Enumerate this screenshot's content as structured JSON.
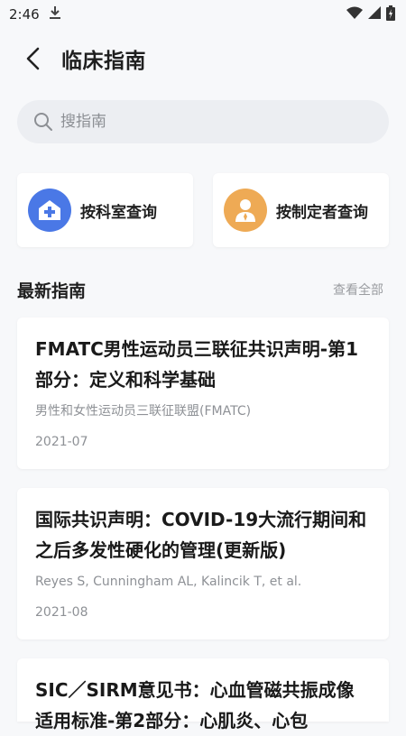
{
  "status_bar": {
    "time": "2:46"
  },
  "header": {
    "title": "临床指南"
  },
  "search": {
    "placeholder": "搜指南"
  },
  "query_cards": [
    {
      "label": "按科室查询",
      "icon": "hospital-icon",
      "color": "#4a78e6"
    },
    {
      "label": "按制定者查询",
      "icon": "person-icon",
      "color": "#eeaa55"
    }
  ],
  "section": {
    "title": "最新指南",
    "view_all": "查看全部"
  },
  "guides": [
    {
      "title": "FMATC男性运动员三联征共识声明-第1部分：定义和科学基础",
      "author": "男性和女性运动员三联征联盟(FMATC)",
      "date": "2021-07"
    },
    {
      "title": "国际共识声明：COVID-19大流行期间和之后多发性硬化的管理(更新版)",
      "author": "Reyes S, Cunningham AL, Kalincik T, et al.",
      "date": "2021-08"
    },
    {
      "title": "SIC／SIRM意见书：心血管磁共振成像适用标准-第2部分：心肌炎、心包"
    }
  ]
}
